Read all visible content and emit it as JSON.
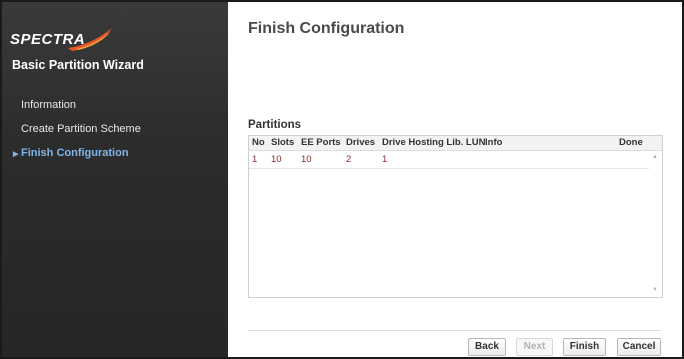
{
  "brand": {
    "logo_text": "SPECTRA",
    "logo_accent_color": "#e8552a"
  },
  "sidebar": {
    "wizard_title": "Basic Partition Wizard",
    "items": [
      {
        "label": "Information",
        "active": false
      },
      {
        "label": "Create Partition Scheme",
        "active": false
      },
      {
        "label": "Finish Configuration",
        "active": true
      }
    ],
    "active_indicator": "triangle-right-icon"
  },
  "main": {
    "title": "Finish Configuration",
    "section_title": "Partitions",
    "table": {
      "columns": [
        "No",
        "Slots",
        "EE Ports",
        "Drives",
        "Drive Hosting Lib. LUN",
        "Info",
        "Done"
      ],
      "rows": [
        [
          "1",
          "10",
          "10",
          "2",
          "1",
          "",
          ""
        ]
      ]
    }
  },
  "footer": {
    "back_label": "Back",
    "next_label": "Next",
    "finish_label": "Finish",
    "cancel_label": "Cancel"
  },
  "colors": {
    "sidebar_bg": "#2c2c2c",
    "active_nav": "#7fb6e8",
    "cell_text": "#8b2a2a"
  }
}
